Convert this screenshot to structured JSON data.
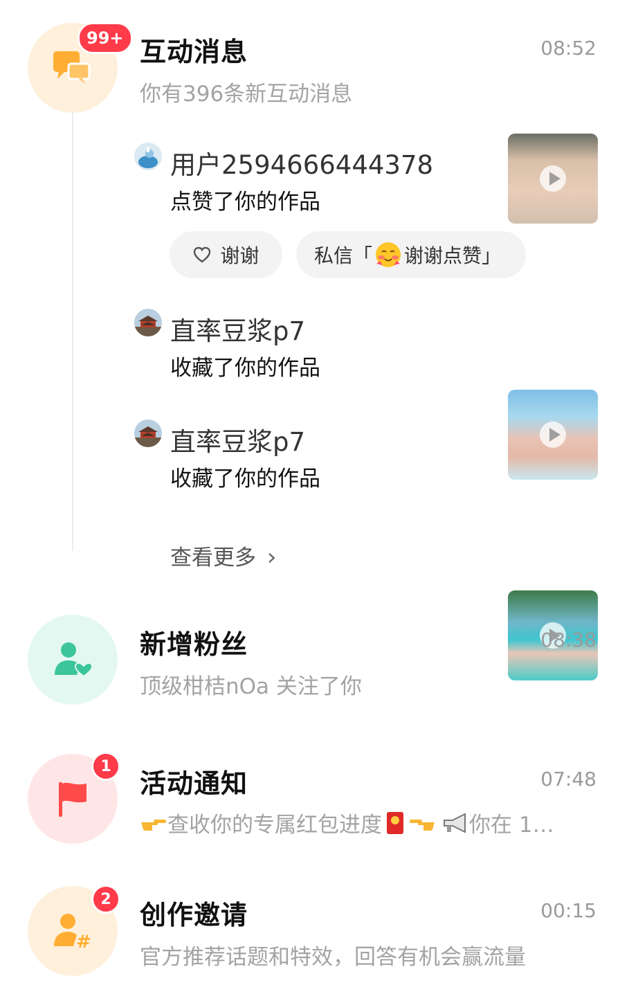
{
  "colors": {
    "interaction_bg": "#fff0dc",
    "interaction_icon": "#ffae33",
    "fans_bg": "#e3f8f1",
    "fans_icon": "#3cc59a",
    "activity_bg": "#ffe6e6",
    "activity_icon": "#ff4a4a",
    "invite_bg": "#fff0dc",
    "invite_icon": "#ffae33",
    "badge": "#ff3b4a"
  },
  "interaction": {
    "icon": "chat-bubbles-icon",
    "badge": "99+",
    "title": "互动消息",
    "time": "08:52",
    "subtitle": "你有396条新互动消息",
    "items": [
      {
        "user": "用户2594666444378",
        "action": "点赞了你的作品",
        "avatar": "bird-avatar"
      },
      {
        "user": "直率豆浆p7",
        "action": "收藏了你的作品",
        "avatar": "building-avatar"
      },
      {
        "user": "直率豆浆p7",
        "action": "收藏了你的作品",
        "avatar": "building-avatar"
      }
    ],
    "thanks_label": "谢谢",
    "dm_prefix": "私信「",
    "dm_text": "谢谢点赞」",
    "more_label": "查看更多",
    "more_arrow": "›"
  },
  "fans": {
    "icon": "user-heart-icon",
    "title": "新增粉丝",
    "time": "08:38",
    "subtitle": "顶级柑桔nOa 关注了你"
  },
  "activity": {
    "icon": "flag-icon",
    "badge": "1",
    "title": "活动通知",
    "time": "07:48",
    "subtitle_part1": "查收你的专属红包进度",
    "subtitle_part2": "你在 1…"
  },
  "invite": {
    "icon": "user-hash-icon",
    "badge": "2",
    "title": "创作邀请",
    "time": "00:15",
    "subtitle": "官方推荐话题和特效，回答有机会赢流量"
  }
}
